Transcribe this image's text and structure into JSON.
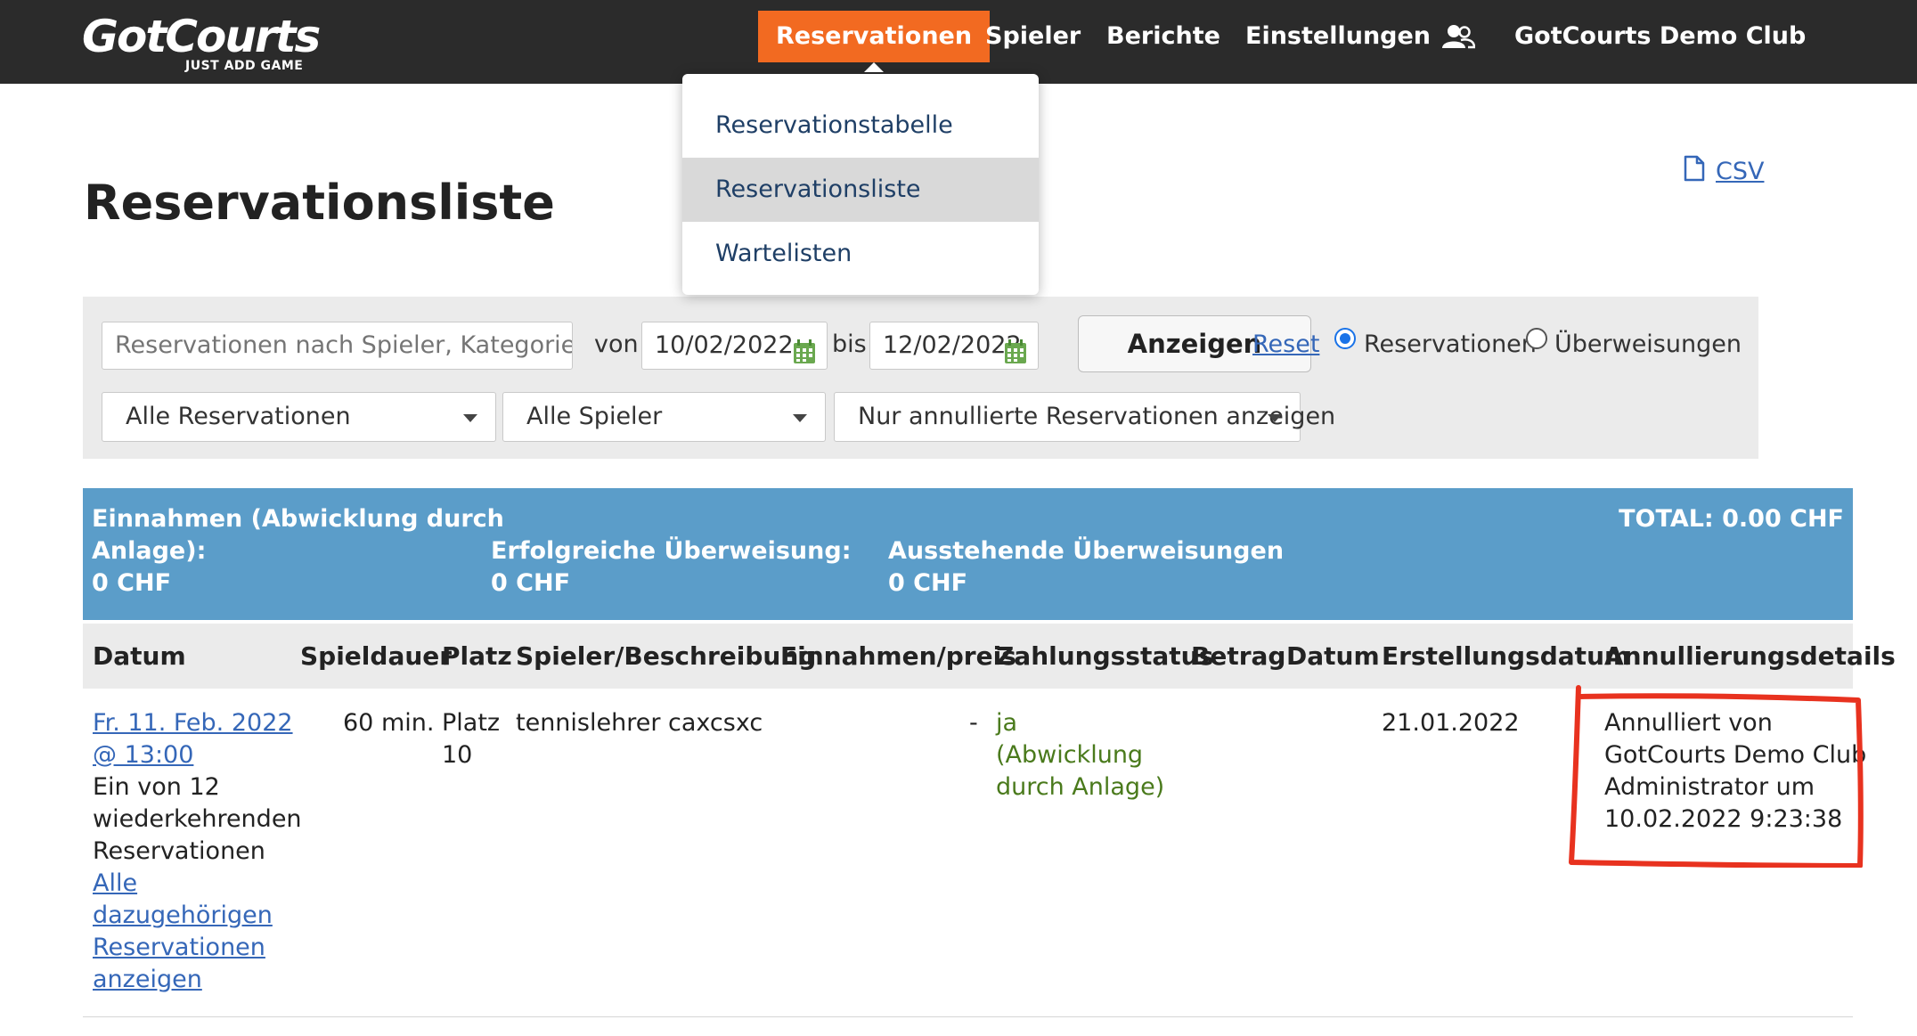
{
  "header": {
    "logo_text": "GotCourts",
    "logo_tagline": "JUST ADD GAME",
    "nav": {
      "reservationen": "Reservationen",
      "spieler": "Spieler",
      "berichte": "Berichte",
      "einstellungen": "Einstellungen",
      "club": "GotCourts Demo Club"
    },
    "icons": {
      "users": "users-icon"
    },
    "colors": {
      "bar": "#2b2b2b",
      "active": "#f26a21"
    }
  },
  "dropdown": {
    "items": [
      "Reservationstabelle",
      "Reservationsliste",
      "Wartelisten"
    ],
    "active": "Reservationsliste"
  },
  "page": {
    "title": "Reservationsliste",
    "csv": "CSV"
  },
  "filters": {
    "search_placeholder": "Reservationen nach Spieler, Kategorie, P...",
    "from_label": "von",
    "from_value": "10/02/2022",
    "to_label": "bis",
    "to_value": "12/02/2022",
    "show_button": "Anzeigen",
    "reset": "Reset",
    "radio_reservations": "Reservationen",
    "radio_transfers": "Überweisungen",
    "radio_selected": "Reservationen",
    "select_reservations": "Alle Reservationen",
    "select_players": "Alle Spieler",
    "select_status": "Nur annullierte Reservationen anzeigen"
  },
  "summary": {
    "income_label_1": "Einnahmen (Abwicklung durch",
    "income_label_2": "Anlage):",
    "income_value": "0 CHF",
    "success_label": "Erfolgreiche Überweisung:",
    "success_value": "0 CHF",
    "pending_label": "Ausstehende Überweisungen",
    "pending_value": "0 CHF",
    "total": "TOTAL: 0.00 CHF",
    "color": "#5b9dc9"
  },
  "table": {
    "headers": [
      "Datum",
      "Spieldauer",
      "Platz",
      "Spieler/Beschreibung",
      "Einnahmen/preis",
      "Zahlungsstatus",
      "Betrag",
      "Datum",
      "Erstellungsdatum",
      "Annullierungsdetails"
    ],
    "rows": [
      {
        "date_link_1": "Fr. 11. Feb. 2022",
        "date_link_2": "@ 13:00",
        "recurring_1": "Ein von 12",
        "recurring_2": "wiederkehrenden",
        "recurring_3": "Reservationen",
        "all_link_1": "Alle",
        "all_link_2": "dazugehörigen",
        "all_link_3": "Reservationen",
        "all_link_4": "anzeigen",
        "duration": "60 min.",
        "court_1": "Platz",
        "court_2": "10",
        "player": "tennislehrer caxcsxc",
        "income": "-",
        "status_1": "ja",
        "status_2": "(Abwicklung",
        "status_3": "durch Anlage)",
        "amount": "",
        "pay_date": "",
        "created": "21.01.2022",
        "cancel_1": "Annulliert von",
        "cancel_2": "GotCourts Demo Club",
        "cancel_3": "Administrator um",
        "cancel_4": "10.02.2022 9:23:38"
      }
    ],
    "highlight_color": "#e8321f"
  }
}
